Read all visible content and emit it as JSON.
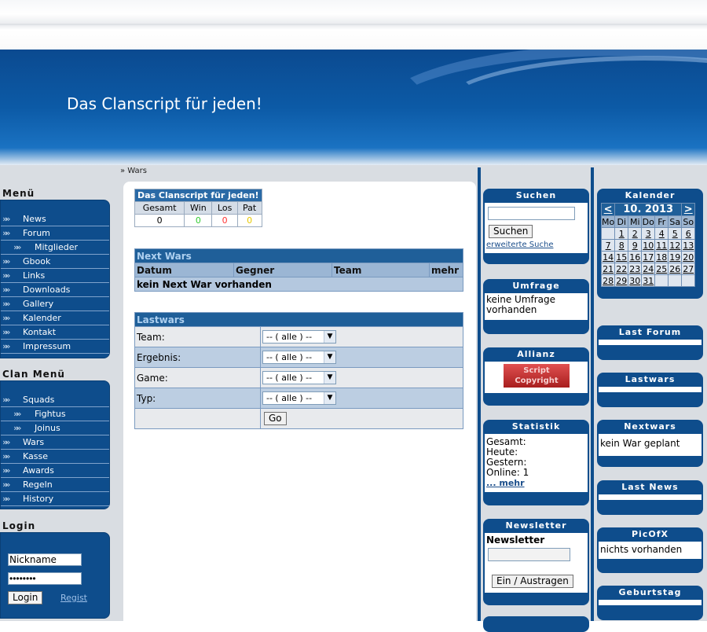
{
  "header": {
    "slogan": "Das Clanscript für jeden!"
  },
  "breadcrumb": "» Wars",
  "menu": {
    "title": "Menü",
    "items": [
      {
        "label": "News",
        "sub": false
      },
      {
        "label": "Forum",
        "sub": false
      },
      {
        "label": "Mitglieder",
        "sub": true
      },
      {
        "label": "Gbook",
        "sub": false
      },
      {
        "label": "Links",
        "sub": false
      },
      {
        "label": "Downloads",
        "sub": false
      },
      {
        "label": "Gallery",
        "sub": false
      },
      {
        "label": "Kalender",
        "sub": false
      },
      {
        "label": "Kontakt",
        "sub": false
      },
      {
        "label": "Impressum",
        "sub": false
      }
    ]
  },
  "clanmenu": {
    "title": "Clan Menü",
    "items": [
      {
        "label": "Squads",
        "sub": false
      },
      {
        "label": "Fightus",
        "sub": true
      },
      {
        "label": "Joinus",
        "sub": true
      },
      {
        "label": "Wars",
        "sub": false
      },
      {
        "label": "Kasse",
        "sub": false
      },
      {
        "label": "Awards",
        "sub": false
      },
      {
        "label": "Regeln",
        "sub": false
      },
      {
        "label": "History",
        "sub": false
      }
    ]
  },
  "login": {
    "title": "Login",
    "nick_value": "Nickname",
    "pass_value": "••••••••",
    "login_label": "Login",
    "regist_label": "Regist"
  },
  "stats": {
    "title": "Das Clanscript für jeden!",
    "headers": [
      "Gesamt",
      "Win",
      "Los",
      "Pat"
    ],
    "values": [
      "0",
      "0",
      "0",
      "0"
    ],
    "colors": [
      "#000000",
      "#33cc33",
      "#ff3333",
      "#e6c800"
    ]
  },
  "nextwars": {
    "title": "Next Wars",
    "cols": [
      "Datum",
      "Gegner",
      "Team",
      "mehr"
    ],
    "empty": "kein Next War vorhanden"
  },
  "lastwars": {
    "title": "Lastwars",
    "rows": [
      {
        "label": "Team:",
        "value": "-- ( alle ) --"
      },
      {
        "label": "Ergebnis:",
        "value": "-- ( alle ) --"
      },
      {
        "label": "Game:",
        "value": "-- ( alle ) --"
      },
      {
        "label": "Typ:",
        "value": "-- ( alle ) --"
      }
    ],
    "go_label": "Go"
  },
  "suchen": {
    "title": "Suchen",
    "button": "Suchen",
    "link": "erweiterte Suche"
  },
  "umfrage": {
    "title": "Umfrage",
    "text": "keine Umfrage vorhanden"
  },
  "allianz": {
    "title": "Allianz",
    "banner_line1": "Script",
    "banner_line2": "Copyright"
  },
  "statistik": {
    "title": "Statistik",
    "lines": [
      "Gesamt:",
      "Heute:",
      "Gestern:",
      "Online: 1"
    ],
    "more": "... mehr"
  },
  "newsletter": {
    "title": "Newsletter",
    "label": "Newsletter",
    "button": "Ein / Austragen"
  },
  "kalender": {
    "title": "Kalender",
    "prev": "<",
    "month": "10. 2013",
    "next": ">",
    "days": [
      "Mo",
      "Di",
      "Mi",
      "Do",
      "Fr",
      "Sa",
      "So"
    ],
    "weeks": [
      [
        "",
        "1",
        "2",
        "3",
        "4",
        "5",
        "6"
      ],
      [
        "7",
        "8",
        "9",
        "10",
        "11",
        "12",
        "13"
      ],
      [
        "14",
        "15",
        "16",
        "17",
        "18",
        "19",
        "20"
      ],
      [
        "21",
        "22",
        "23",
        "24",
        "25",
        "26",
        "27"
      ],
      [
        "28",
        "29",
        "30",
        "31",
        "",
        "",
        ""
      ]
    ]
  },
  "lastforum": {
    "title": "Last Forum"
  },
  "lastwars_box": {
    "title": "Lastwars"
  },
  "nextwars_box": {
    "title": "Nextwars",
    "text": "kein War geplant"
  },
  "lastnews": {
    "title": "Last News"
  },
  "picofx": {
    "title": "PicOfX",
    "text": "nichts vorhanden"
  },
  "geburtstag": {
    "title": "Geburtstag"
  }
}
